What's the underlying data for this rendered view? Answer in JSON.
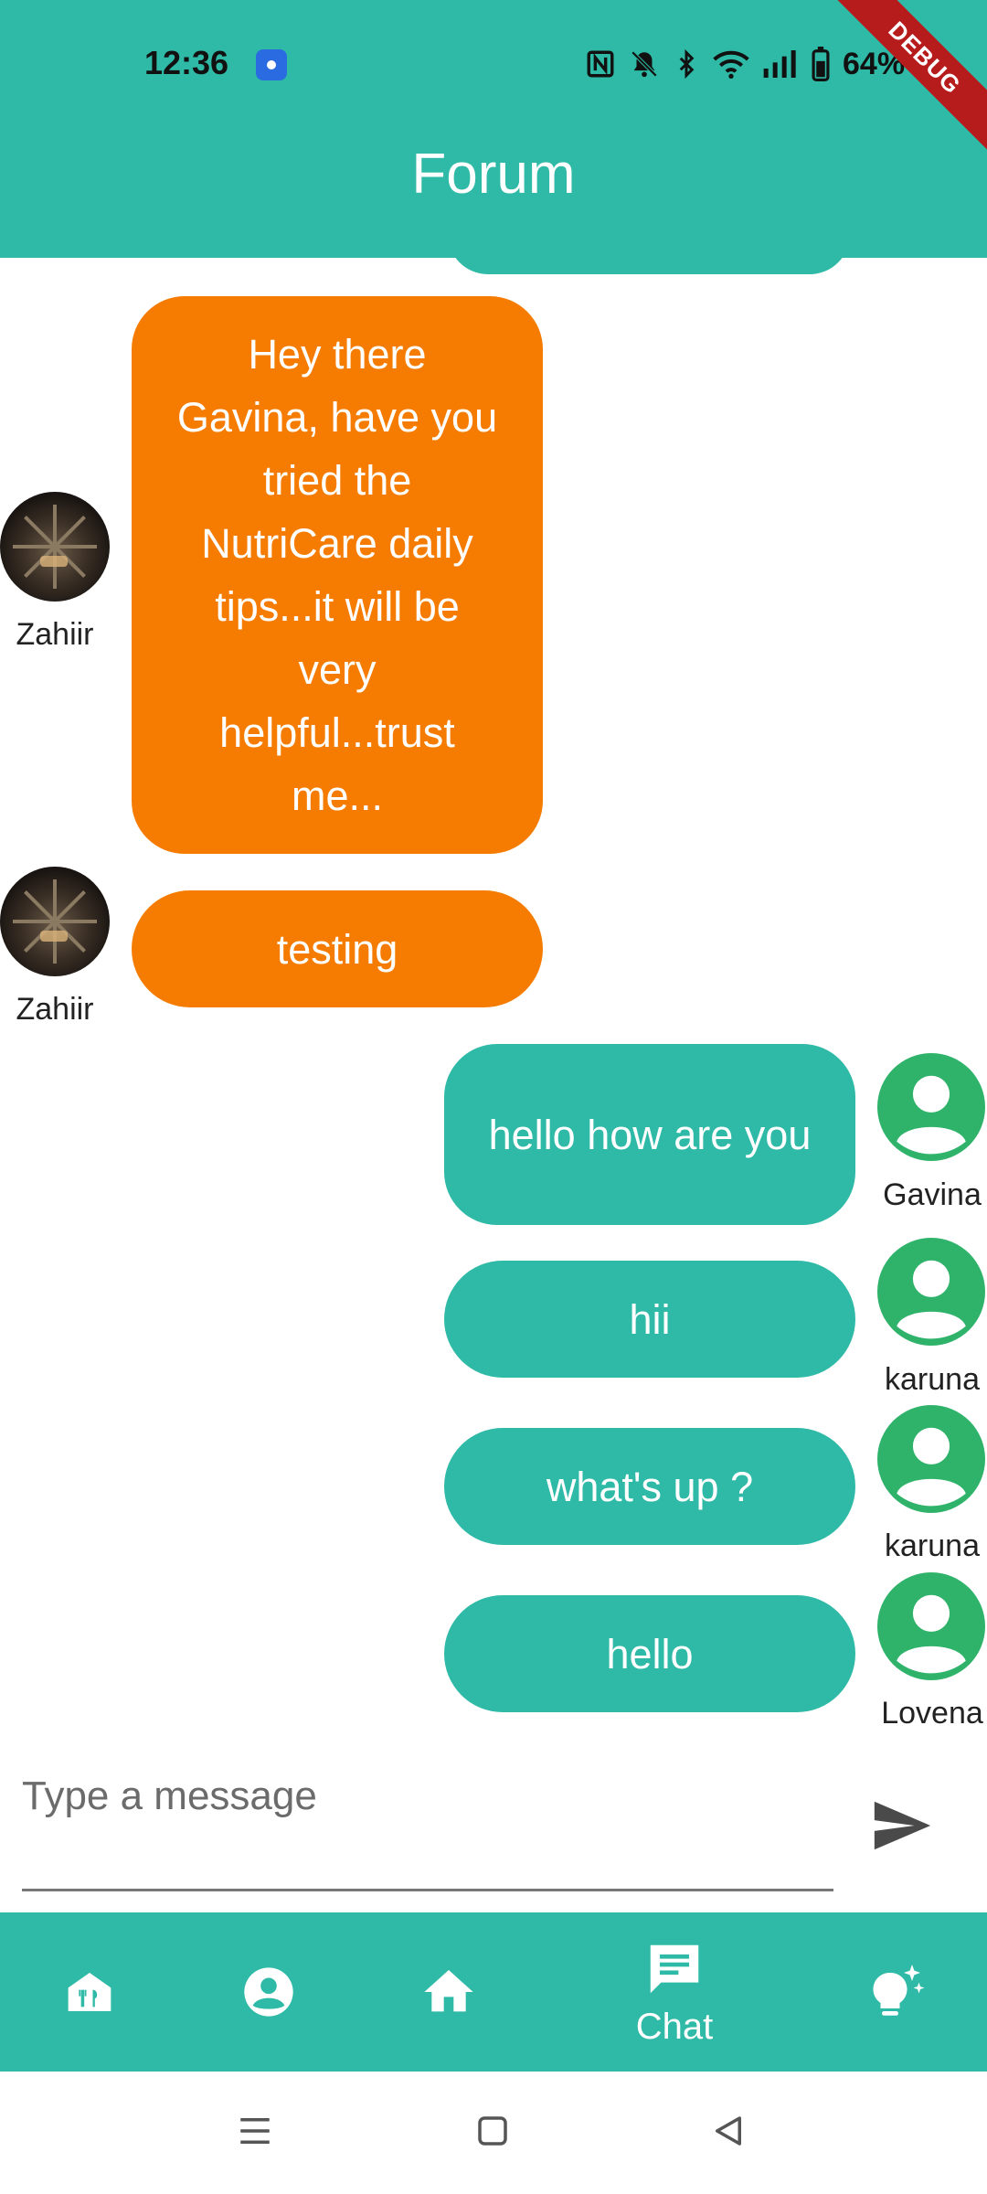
{
  "status_bar": {
    "time": "12:36",
    "battery": "64%",
    "debug_banner": "DEBUG"
  },
  "header": {
    "title": "Forum"
  },
  "messages": [
    {
      "sender": "Zahiir",
      "side": "left",
      "text": "Hey there Gavina, have you tried the NutriCare daily tips...it will be very helpful...trust me...",
      "color": "#f57c00"
    },
    {
      "sender": "Zahiir",
      "side": "left",
      "text": "testing",
      "color": "#f57c00"
    },
    {
      "sender": "Gavina",
      "side": "right",
      "text": "hello how are you",
      "color": "#2ebaa6"
    },
    {
      "sender": "karuna",
      "side": "right",
      "text": "hii",
      "color": "#2ebaa6"
    },
    {
      "sender": "karuna",
      "side": "right",
      "text": "what's up ?",
      "color": "#2ebaa6"
    },
    {
      "sender": "Lovena",
      "side": "right",
      "text": "hello",
      "color": "#2ebaa6"
    }
  ],
  "composer": {
    "placeholder": "Type a message",
    "send_icon": "send-icon"
  },
  "bottom_nav": {
    "items": [
      {
        "icon": "restaurant-home-icon"
      },
      {
        "icon": "account-circle-icon"
      },
      {
        "icon": "home-icon"
      },
      {
        "icon": "chat-icon",
        "label": "Chat",
        "selected": true
      },
      {
        "icon": "lightbulb-sparkle-icon"
      }
    ]
  },
  "colors": {
    "primary": "#2ebaa6",
    "accent": "#f57c00",
    "avatar_green": "#2fb36a"
  }
}
